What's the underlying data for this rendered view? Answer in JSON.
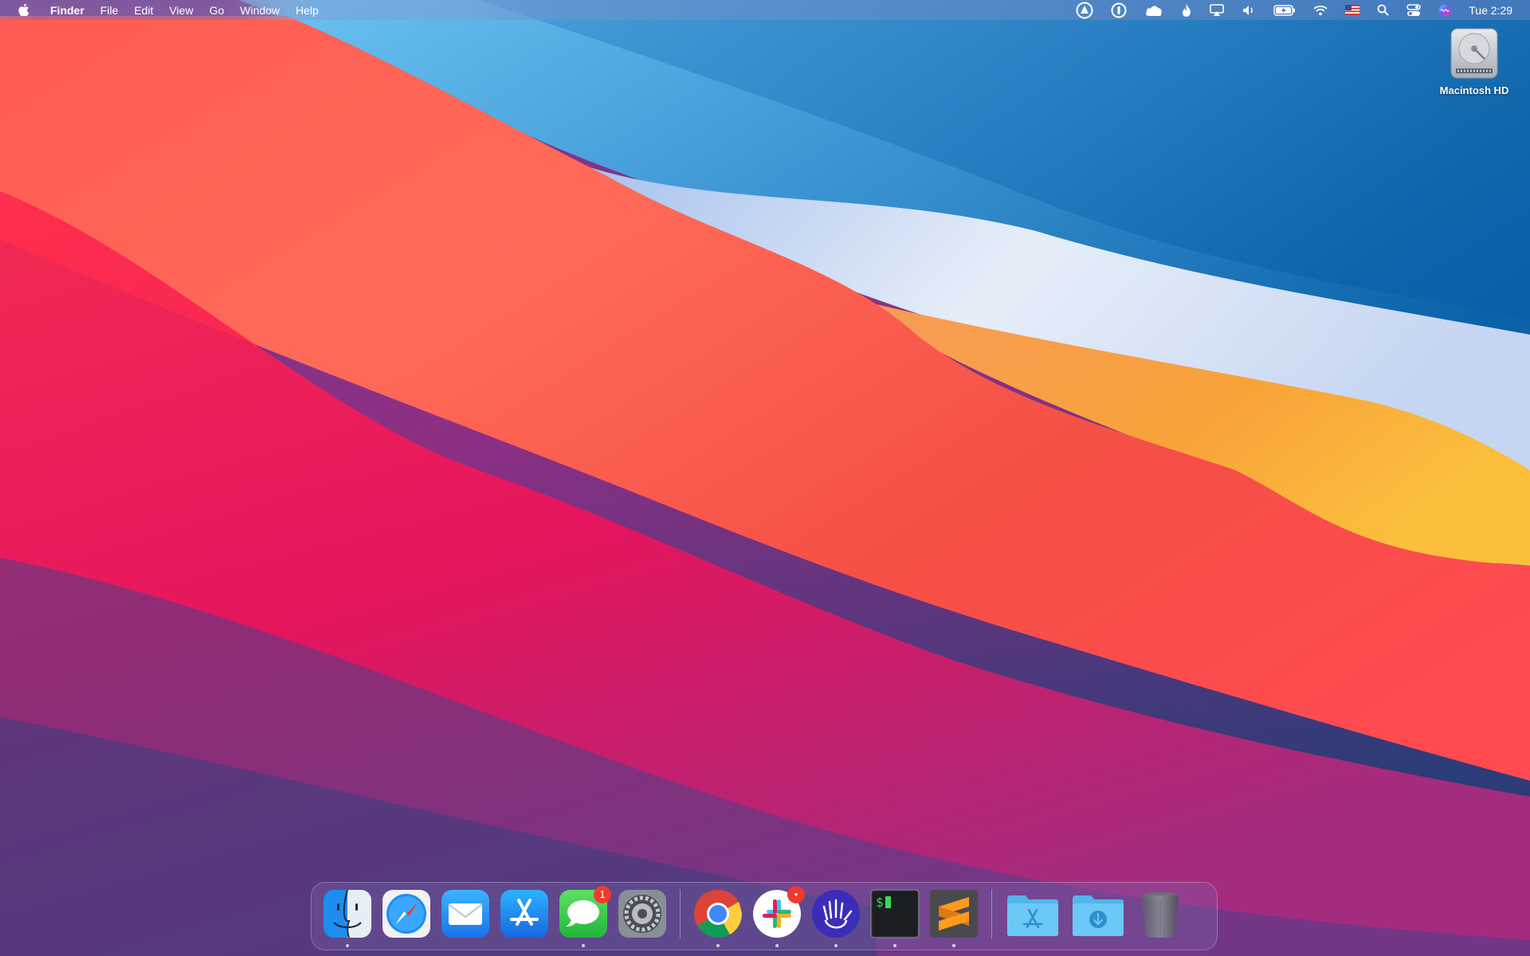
{
  "menubar": {
    "apple_icon": "apple-logo-icon",
    "app_name": "Finder",
    "menus": [
      "File",
      "Edit",
      "View",
      "Go",
      "Window",
      "Help"
    ],
    "status_icons": [
      "alert-triangle-circle-icon",
      "password-manager-icon",
      "cloud-icon",
      "flame-icon",
      "airplay-icon",
      "volume-icon",
      "battery-icon",
      "wifi-icon",
      "us-flag-icon",
      "spotlight-search-icon",
      "control-center-icon",
      "siri-icon"
    ],
    "clock": "Tue 2:29"
  },
  "desktop": {
    "icons": [
      {
        "label": "Macintosh HD",
        "icon": "hard-drive-icon"
      }
    ]
  },
  "dock": {
    "apps": [
      {
        "name": "Finder",
        "icon": "finder-icon",
        "running": true,
        "badge": ""
      },
      {
        "name": "Safari",
        "icon": "safari-icon",
        "running": false,
        "badge": ""
      },
      {
        "name": "Mail",
        "icon": "mail-icon",
        "running": false,
        "badge": ""
      },
      {
        "name": "App Store",
        "icon": "app-store-icon",
        "running": false,
        "badge": ""
      },
      {
        "name": "Messages",
        "icon": "messages-icon",
        "running": true,
        "badge": "1"
      },
      {
        "name": "System Preferences",
        "icon": "system-preferences-icon",
        "running": false,
        "badge": ""
      },
      {
        "name": "Google Chrome",
        "icon": "chrome-icon",
        "running": true,
        "badge": ""
      },
      {
        "name": "Slack",
        "icon": "slack-icon",
        "running": true,
        "badge": "•"
      },
      {
        "name": "Hand app",
        "icon": "hand-icon",
        "running": true,
        "badge": ""
      },
      {
        "name": "Terminal",
        "icon": "terminal-icon",
        "running": true,
        "badge": ""
      },
      {
        "name": "Sublime Text",
        "icon": "sublime-text-icon",
        "running": true,
        "badge": ""
      },
      {
        "name": "Applications",
        "icon": "applications-folder-icon",
        "running": false,
        "badge": ""
      },
      {
        "name": "Downloads",
        "icon": "downloads-folder-icon",
        "running": false,
        "badge": ""
      },
      {
        "name": "Trash",
        "icon": "trash-icon",
        "running": false,
        "badge": ""
      }
    ],
    "terminal_prompt": "$"
  },
  "colors": {
    "sky_blue": "#4aa6e0",
    "deep_blue": "#0f6db3",
    "red": "#f7314a",
    "coral": "#ff6a4c",
    "orange": "#f7a33c",
    "magenta": "#c2257a",
    "purple": "#4a3f8a"
  }
}
